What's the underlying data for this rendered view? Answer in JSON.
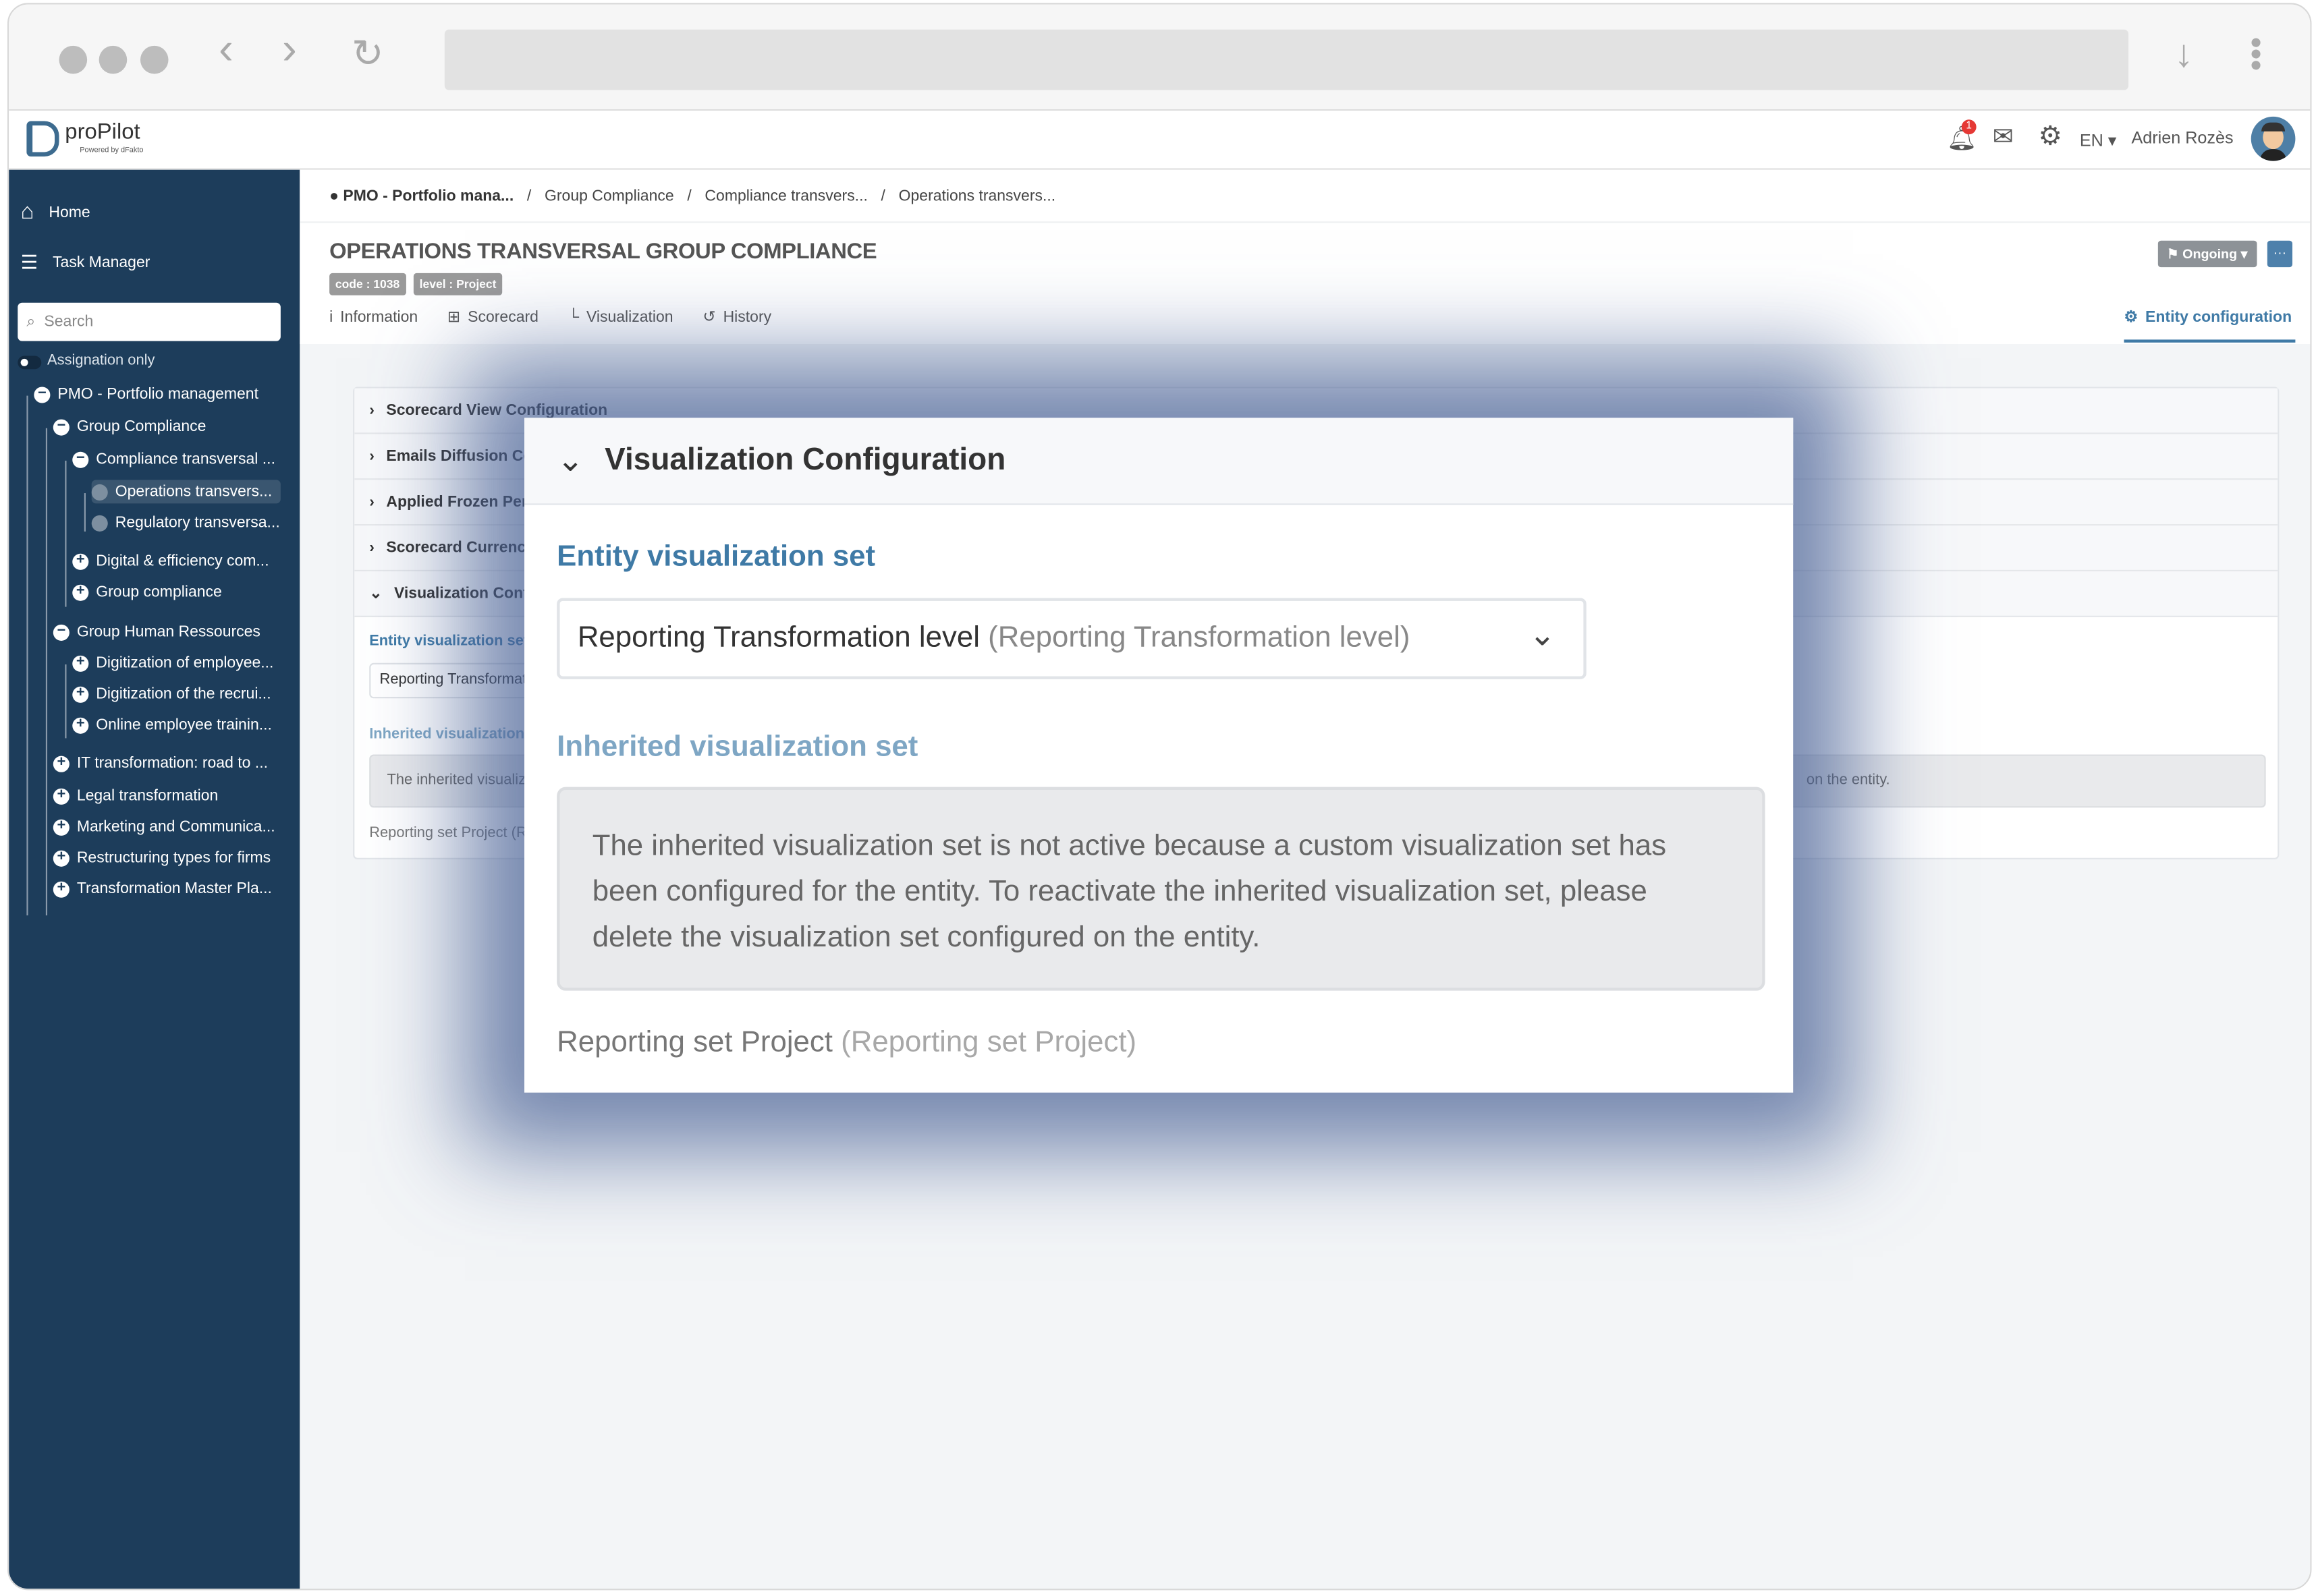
{
  "browser": {
    "icons": [
      "window-dot",
      "window-dot",
      "window-dot",
      "back-icon",
      "forward-icon",
      "reload-icon",
      "download-icon",
      "menu-icon"
    ]
  },
  "header": {
    "logo_text": "proPilot",
    "logo_sub": "Powered by dFakto",
    "notifications": "1",
    "language": "EN",
    "user": "Adrien Rozès"
  },
  "sidebar": {
    "home": "Home",
    "task_manager": "Task Manager",
    "search_placeholder": "Search",
    "assignation": "Assignation only",
    "tree": [
      {
        "label": "PMO - Portfolio management",
        "state": "open"
      },
      {
        "label": "Group Compliance",
        "state": "open"
      },
      {
        "label": "Compliance transversal ...",
        "state": "open"
      },
      {
        "label": "Operations transvers...",
        "state": "leaf",
        "selected": true
      },
      {
        "label": "Regulatory transversa...",
        "state": "leaf"
      },
      {
        "label": "Digital & efficiency com...",
        "state": "closed"
      },
      {
        "label": "Group compliance",
        "state": "closed"
      },
      {
        "label": "Group Human Ressources",
        "state": "open"
      },
      {
        "label": "Digitization of employee...",
        "state": "closed"
      },
      {
        "label": "Digitization of the recrui...",
        "state": "closed"
      },
      {
        "label": "Online employee trainin...",
        "state": "closed"
      },
      {
        "label": "IT transformation: road to ...",
        "state": "closed"
      },
      {
        "label": "Legal transformation",
        "state": "closed"
      },
      {
        "label": "Marketing and Communica...",
        "state": "closed"
      },
      {
        "label": "Restructuring types for firms",
        "state": "closed"
      },
      {
        "label": "Transformation Master Pla...",
        "state": "closed"
      }
    ]
  },
  "breadcrumb": [
    "PMO - Portfolio mana...",
    "Group Compliance",
    "Compliance transvers...",
    "Operations transvers..."
  ],
  "page": {
    "title": "OPERATIONS TRANSVERSAL GROUP COMPLIANCE",
    "code_badge": "code : 1038",
    "level_badge": "level : Project",
    "status": "Ongoing",
    "more": "···"
  },
  "tabs": [
    "Information",
    "Scorecard",
    "Visualization",
    "History"
  ],
  "entity_config_tab": "Entity configuration",
  "accordions": [
    "Scorecard View Configuration",
    "Emails Diffusion Co",
    "Applied Frozen Peri",
    "Scorecard Currency",
    "Visualization Confi"
  ],
  "background_panel": {
    "entity_label": "Entity visualization set",
    "select_value": "Reporting Transformat",
    "inherited_label": "Inherited visualization s",
    "info_start": "The inherited visualiz",
    "info_end": "on the entity.",
    "footer": "Reporting set Project (R"
  },
  "modal": {
    "title": "Visualization Configuration",
    "entity_label": "Entity visualization set",
    "select_value": "Reporting Transformation level",
    "select_secondary": "(Reporting Transformation level)",
    "inherited_label": "Inherited visualization set",
    "info": "The inherited visualization set is not active because a custom visualization set has been configured for the entity. To reactivate the inherited visualization set, please delete the visualization set configured on the entity.",
    "footer_value": "Reporting set Project",
    "footer_secondary": "(Reporting set Project)"
  },
  "colors": {
    "sidebar": "#1d3d5b",
    "accent": "#3f7aa6",
    "badge": "#e53935"
  }
}
